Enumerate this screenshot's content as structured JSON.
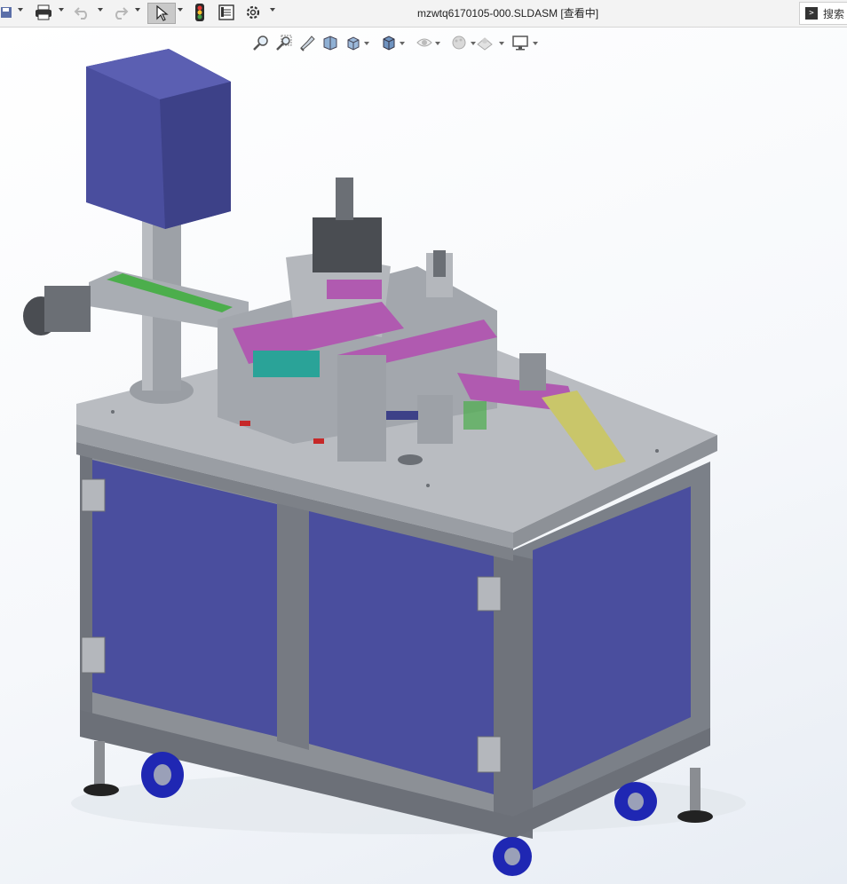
{
  "window": {
    "title": "mzwtq6170105-000.SLDASM [查看中]"
  },
  "toolbar": {
    "items": [
      "save-icon",
      "print-icon",
      "undo-icon",
      "redo-icon",
      "select-icon",
      "traffic-light-icon",
      "file-properties-icon",
      "options-gear-icon"
    ]
  },
  "search": {
    "label": "搜索"
  },
  "heads_up_toolbar": {
    "items": [
      "zoom-to-fit-icon",
      "zoom-to-area-icon",
      "previous-view-icon",
      "section-view-icon",
      "view-orientation-icon",
      "display-style-icon",
      "hide-show-items-icon",
      "edit-appearance-icon",
      "apply-scene-icon",
      "view-settings-icon"
    ]
  },
  "colors": {
    "panel_blue": "#4a4e9e",
    "frame_gray": "#8c9096",
    "conveyor_green": "#4cae4c",
    "accent_magenta": "#b05ab0",
    "chute_yellow": "#c9c66a"
  }
}
